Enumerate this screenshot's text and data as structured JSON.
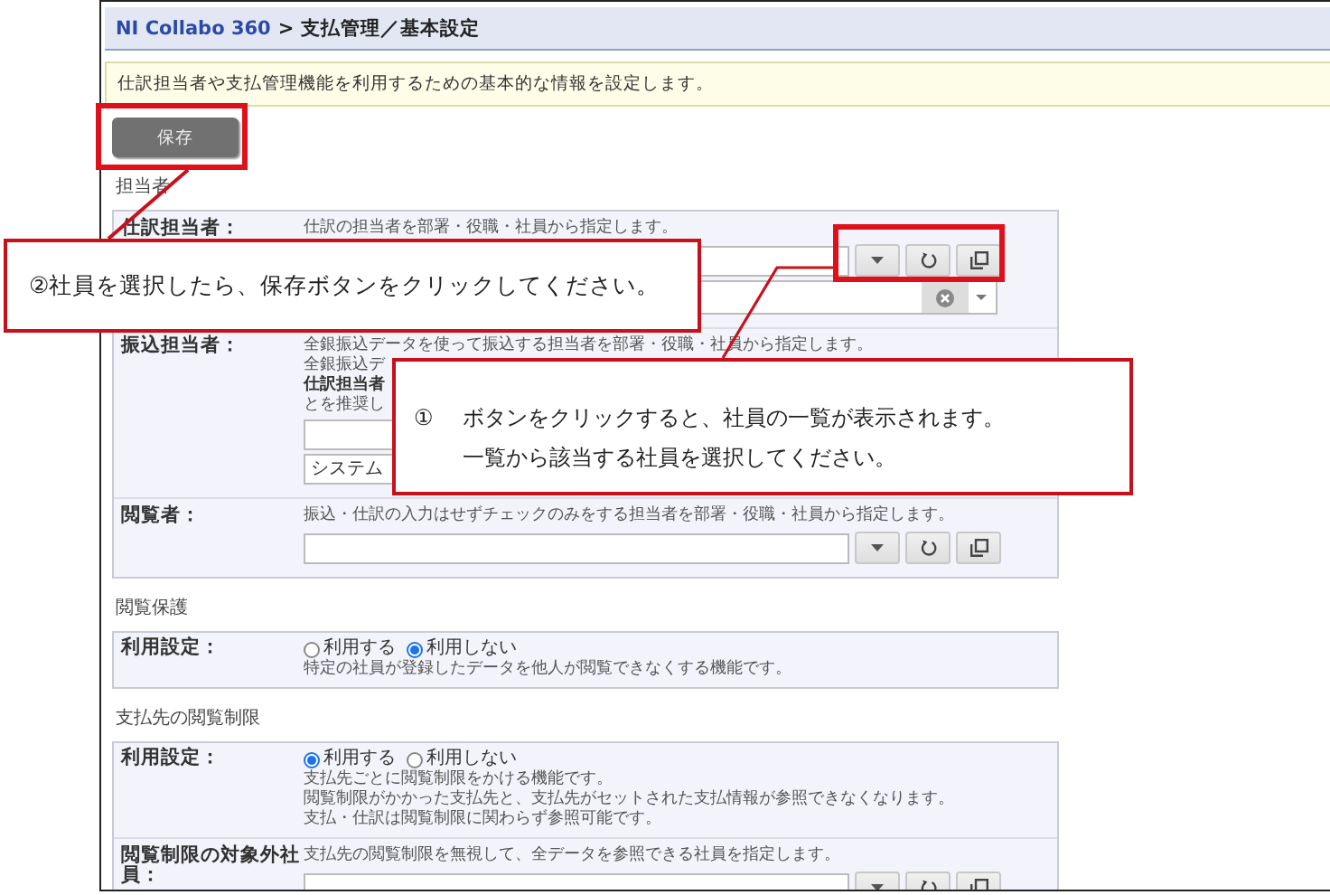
{
  "breadcrumb": {
    "app": "NI Collabo 360",
    "separator": ">",
    "page": "支払管理／基本設定"
  },
  "info": "仕訳担当者や支払管理機能を利用するための基本的な情報を設定します。",
  "save_button": "保存",
  "sections": [
    {
      "title": "担当者",
      "rows": [
        {
          "label": "仕訳担当者：",
          "description": [
            "仕訳の担当者を部署・役職・社員から指定します。"
          ],
          "fields": [
            {
              "kind": "picker"
            },
            {
              "kind": "select"
            }
          ]
        },
        {
          "label": "振込担当者：",
          "description": [
            "全銀振込データを使って振込する担当者を部署・役職・社員から指定します。",
            "全銀振込デ",
            "**仕訳担当者**",
            "とを推奨し"
          ],
          "fields": [
            {
              "kind": "text"
            },
            {
              "kind": "text",
              "value": "システム"
            }
          ]
        },
        {
          "label": "閲覧者：",
          "description": [
            "振込・仕訳の入力はせずチェックのみをする担当者を部署・役職・社員から指定します。"
          ],
          "fields": [
            {
              "kind": "picker"
            }
          ]
        }
      ]
    },
    {
      "title": "閲覧保護",
      "rows": [
        {
          "label": "利用設定：",
          "options": [
            {
              "label": "利用する",
              "selected": false
            },
            {
              "label": "利用しない",
              "selected": true
            }
          ],
          "description": [
            "特定の社員が登録したデータを他人が閲覧できなくする機能です。"
          ]
        }
      ]
    },
    {
      "title": "支払先の閲覧制限",
      "rows": [
        {
          "label": "利用設定：",
          "options": [
            {
              "label": "利用する",
              "selected": true
            },
            {
              "label": "利用しない",
              "selected": false
            }
          ],
          "description": [
            "支払先ごとに閲覧制限をかける機能です。",
            "閲覧制限がかかった支払先と、支払先がセットされた支払情報が参照できなくなります。",
            "支払・仕訳は閲覧制限に関わらず参照可能です。"
          ]
        },
        {
          "label": "閲覧制限の対象外社員：",
          "description": [
            "支払先の閲覧制限を無視して、全データを参照できる社員を指定します。"
          ],
          "fields": [
            {
              "kind": "picker"
            }
          ]
        }
      ]
    }
  ],
  "callouts": [
    {
      "marker": "②",
      "text": "社員を選択したら、保存ボタンをクリックしてください。"
    },
    {
      "marker": "①",
      "lines": [
        "ボタンをクリックすると、社員の一覧が表示されます。",
        "一覧から該当する社員を選択してください。"
      ]
    }
  ]
}
